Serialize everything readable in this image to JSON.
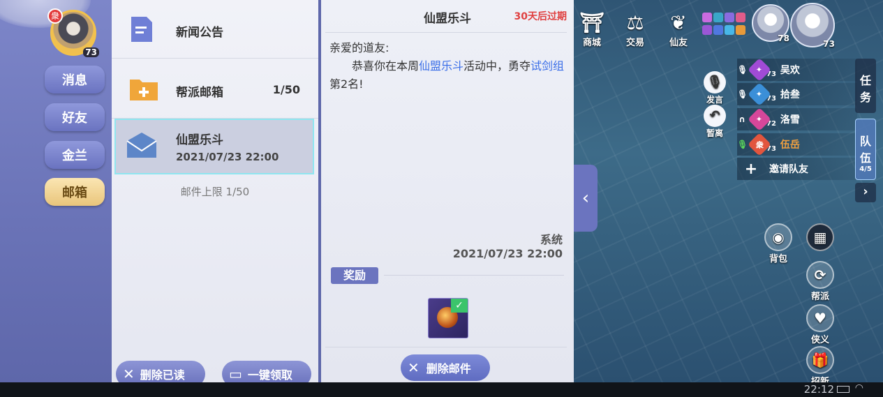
{
  "player": {
    "level": "73",
    "badge": "衆"
  },
  "nav": {
    "items": [
      {
        "label": "消息"
      },
      {
        "label": "好友"
      },
      {
        "label": "金兰"
      },
      {
        "label": "邮箱"
      }
    ],
    "active": "邮箱"
  },
  "mail_list": {
    "items": [
      {
        "title": "新闻公告"
      },
      {
        "title": "帮派邮箱",
        "count": "1/50"
      },
      {
        "title": "仙盟乐斗",
        "date": "2021/07/23 22:00"
      }
    ],
    "limit_text": "邮件上限 1/50",
    "delete_read_label": "删除已读",
    "claim_all_label": "一键领取"
  },
  "mail_detail": {
    "title": "仙盟乐斗",
    "expire": "30天后过期",
    "greeting": "亲爱的道友:",
    "body_1": "恭喜你在本周",
    "body_hl_1": "仙盟乐斗",
    "body_2": "活动中，勇夺",
    "body_hl_2": "试剑组",
    "body_3": "第2名!",
    "sender": "系统",
    "date": "2021/07/23 22:00",
    "reward_label": "奖励",
    "delete_label": "删除邮件"
  },
  "scene": {
    "top_icons": [
      {
        "label": "商城",
        "icon": "mall-icon"
      },
      {
        "label": "交易",
        "icon": "trade-icon"
      },
      {
        "label": "仙友",
        "icon": "friends-icon"
      }
    ],
    "party_avatars": [
      {
        "level": "78"
      },
      {
        "level": "73"
      }
    ],
    "voice_label": "发言",
    "leave_label": "暂离",
    "team": [
      {
        "name": "吴欢",
        "level": "73",
        "color": "#a14bd6"
      },
      {
        "name": "拾叁",
        "level": "73",
        "color": "#3b8fd8"
      },
      {
        "name": "洛雪",
        "level": "72",
        "color": "#d6479a"
      },
      {
        "name": "伍岳",
        "level": "73",
        "color": "#e2553e",
        "highlight": "#f0a040"
      }
    ],
    "invite_label": "邀请队友",
    "tab_task": "任务",
    "tab_team": "队伍",
    "tab_team_count": "4/5",
    "right_icons": [
      {
        "label": "背包",
        "icon": "bag-icon"
      },
      {
        "label": "帮派",
        "icon": "guild-icon"
      },
      {
        "label": "侠义",
        "icon": "chivalry-icon"
      },
      {
        "label": "招新",
        "icon": "recruit-icon"
      }
    ]
  },
  "status_bar": {
    "clock": "22:12"
  }
}
